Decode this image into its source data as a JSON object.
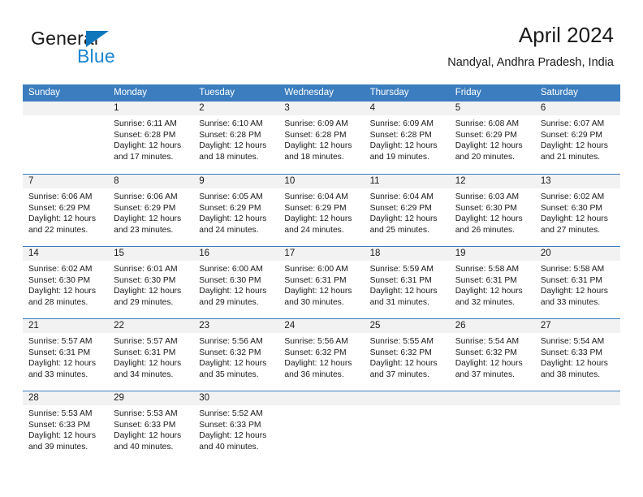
{
  "brand": {
    "name_part1": "General",
    "name_part2": "Blue",
    "accent_color": "#1b86d0",
    "triangle_color": "#1076bc"
  },
  "header": {
    "title": "April 2024",
    "subtitle": "Nandyal, Andhra Pradesh, India"
  },
  "calendar": {
    "header_bg": "#3b7dbf",
    "day_band_bg": "#f2f2f2",
    "weekdays": [
      "Sunday",
      "Monday",
      "Tuesday",
      "Wednesday",
      "Thursday",
      "Friday",
      "Saturday"
    ],
    "weeks": [
      [
        {
          "day": "",
          "empty": true,
          "sunrise": "",
          "sunset": "",
          "daylight_a": "",
          "daylight_b": ""
        },
        {
          "day": "1",
          "sunrise": "Sunrise: 6:11 AM",
          "sunset": "Sunset: 6:28 PM",
          "daylight_a": "Daylight: 12 hours",
          "daylight_b": "and 17 minutes."
        },
        {
          "day": "2",
          "sunrise": "Sunrise: 6:10 AM",
          "sunset": "Sunset: 6:28 PM",
          "daylight_a": "Daylight: 12 hours",
          "daylight_b": "and 18 minutes."
        },
        {
          "day": "3",
          "sunrise": "Sunrise: 6:09 AM",
          "sunset": "Sunset: 6:28 PM",
          "daylight_a": "Daylight: 12 hours",
          "daylight_b": "and 18 minutes."
        },
        {
          "day": "4",
          "sunrise": "Sunrise: 6:09 AM",
          "sunset": "Sunset: 6:28 PM",
          "daylight_a": "Daylight: 12 hours",
          "daylight_b": "and 19 minutes."
        },
        {
          "day": "5",
          "sunrise": "Sunrise: 6:08 AM",
          "sunset": "Sunset: 6:29 PM",
          "daylight_a": "Daylight: 12 hours",
          "daylight_b": "and 20 minutes."
        },
        {
          "day": "6",
          "sunrise": "Sunrise: 6:07 AM",
          "sunset": "Sunset: 6:29 PM",
          "daylight_a": "Daylight: 12 hours",
          "daylight_b": "and 21 minutes."
        }
      ],
      [
        {
          "day": "7",
          "sunrise": "Sunrise: 6:06 AM",
          "sunset": "Sunset: 6:29 PM",
          "daylight_a": "Daylight: 12 hours",
          "daylight_b": "and 22 minutes."
        },
        {
          "day": "8",
          "sunrise": "Sunrise: 6:06 AM",
          "sunset": "Sunset: 6:29 PM",
          "daylight_a": "Daylight: 12 hours",
          "daylight_b": "and 23 minutes."
        },
        {
          "day": "9",
          "sunrise": "Sunrise: 6:05 AM",
          "sunset": "Sunset: 6:29 PM",
          "daylight_a": "Daylight: 12 hours",
          "daylight_b": "and 24 minutes."
        },
        {
          "day": "10",
          "sunrise": "Sunrise: 6:04 AM",
          "sunset": "Sunset: 6:29 PM",
          "daylight_a": "Daylight: 12 hours",
          "daylight_b": "and 24 minutes."
        },
        {
          "day": "11",
          "sunrise": "Sunrise: 6:04 AM",
          "sunset": "Sunset: 6:29 PM",
          "daylight_a": "Daylight: 12 hours",
          "daylight_b": "and 25 minutes."
        },
        {
          "day": "12",
          "sunrise": "Sunrise: 6:03 AM",
          "sunset": "Sunset: 6:30 PM",
          "daylight_a": "Daylight: 12 hours",
          "daylight_b": "and 26 minutes."
        },
        {
          "day": "13",
          "sunrise": "Sunrise: 6:02 AM",
          "sunset": "Sunset: 6:30 PM",
          "daylight_a": "Daylight: 12 hours",
          "daylight_b": "and 27 minutes."
        }
      ],
      [
        {
          "day": "14",
          "sunrise": "Sunrise: 6:02 AM",
          "sunset": "Sunset: 6:30 PM",
          "daylight_a": "Daylight: 12 hours",
          "daylight_b": "and 28 minutes."
        },
        {
          "day": "15",
          "sunrise": "Sunrise: 6:01 AM",
          "sunset": "Sunset: 6:30 PM",
          "daylight_a": "Daylight: 12 hours",
          "daylight_b": "and 29 minutes."
        },
        {
          "day": "16",
          "sunrise": "Sunrise: 6:00 AM",
          "sunset": "Sunset: 6:30 PM",
          "daylight_a": "Daylight: 12 hours",
          "daylight_b": "and 29 minutes."
        },
        {
          "day": "17",
          "sunrise": "Sunrise: 6:00 AM",
          "sunset": "Sunset: 6:31 PM",
          "daylight_a": "Daylight: 12 hours",
          "daylight_b": "and 30 minutes."
        },
        {
          "day": "18",
          "sunrise": "Sunrise: 5:59 AM",
          "sunset": "Sunset: 6:31 PM",
          "daylight_a": "Daylight: 12 hours",
          "daylight_b": "and 31 minutes."
        },
        {
          "day": "19",
          "sunrise": "Sunrise: 5:58 AM",
          "sunset": "Sunset: 6:31 PM",
          "daylight_a": "Daylight: 12 hours",
          "daylight_b": "and 32 minutes."
        },
        {
          "day": "20",
          "sunrise": "Sunrise: 5:58 AM",
          "sunset": "Sunset: 6:31 PM",
          "daylight_a": "Daylight: 12 hours",
          "daylight_b": "and 33 minutes."
        }
      ],
      [
        {
          "day": "21",
          "sunrise": "Sunrise: 5:57 AM",
          "sunset": "Sunset: 6:31 PM",
          "daylight_a": "Daylight: 12 hours",
          "daylight_b": "and 33 minutes."
        },
        {
          "day": "22",
          "sunrise": "Sunrise: 5:57 AM",
          "sunset": "Sunset: 6:31 PM",
          "daylight_a": "Daylight: 12 hours",
          "daylight_b": "and 34 minutes."
        },
        {
          "day": "23",
          "sunrise": "Sunrise: 5:56 AM",
          "sunset": "Sunset: 6:32 PM",
          "daylight_a": "Daylight: 12 hours",
          "daylight_b": "and 35 minutes."
        },
        {
          "day": "24",
          "sunrise": "Sunrise: 5:56 AM",
          "sunset": "Sunset: 6:32 PM",
          "daylight_a": "Daylight: 12 hours",
          "daylight_b": "and 36 minutes."
        },
        {
          "day": "25",
          "sunrise": "Sunrise: 5:55 AM",
          "sunset": "Sunset: 6:32 PM",
          "daylight_a": "Daylight: 12 hours",
          "daylight_b": "and 37 minutes."
        },
        {
          "day": "26",
          "sunrise": "Sunrise: 5:54 AM",
          "sunset": "Sunset: 6:32 PM",
          "daylight_a": "Daylight: 12 hours",
          "daylight_b": "and 37 minutes."
        },
        {
          "day": "27",
          "sunrise": "Sunrise: 5:54 AM",
          "sunset": "Sunset: 6:33 PM",
          "daylight_a": "Daylight: 12 hours",
          "daylight_b": "and 38 minutes."
        }
      ],
      [
        {
          "day": "28",
          "sunrise": "Sunrise: 5:53 AM",
          "sunset": "Sunset: 6:33 PM",
          "daylight_a": "Daylight: 12 hours",
          "daylight_b": "and 39 minutes."
        },
        {
          "day": "29",
          "sunrise": "Sunrise: 5:53 AM",
          "sunset": "Sunset: 6:33 PM",
          "daylight_a": "Daylight: 12 hours",
          "daylight_b": "and 40 minutes."
        },
        {
          "day": "30",
          "sunrise": "Sunrise: 5:52 AM",
          "sunset": "Sunset: 6:33 PM",
          "daylight_a": "Daylight: 12 hours",
          "daylight_b": "and 40 minutes."
        },
        {
          "day": "",
          "empty": true,
          "sunrise": "",
          "sunset": "",
          "daylight_a": "",
          "daylight_b": ""
        },
        {
          "day": "",
          "empty": true,
          "sunrise": "",
          "sunset": "",
          "daylight_a": "",
          "daylight_b": ""
        },
        {
          "day": "",
          "empty": true,
          "sunrise": "",
          "sunset": "",
          "daylight_a": "",
          "daylight_b": ""
        },
        {
          "day": "",
          "empty": true,
          "sunrise": "",
          "sunset": "",
          "daylight_a": "",
          "daylight_b": ""
        }
      ]
    ]
  }
}
